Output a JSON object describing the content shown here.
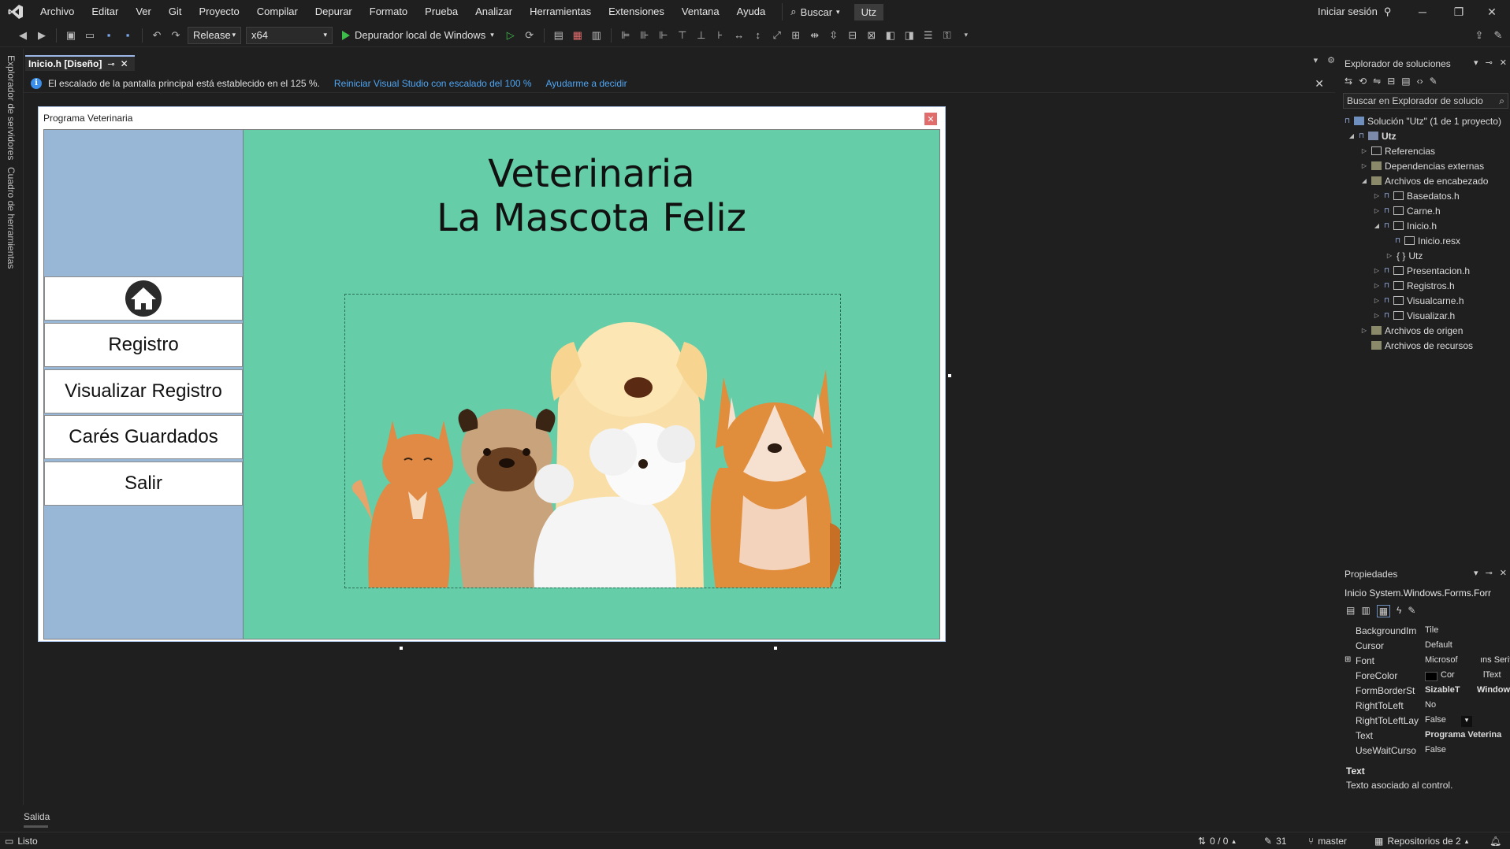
{
  "menubar": {
    "items": [
      "Archivo",
      "Editar",
      "Ver",
      "Git",
      "Proyecto",
      "Compilar",
      "Depurar",
      "Formato",
      "Prueba",
      "Analizar",
      "Herramientas",
      "Extensiones",
      "Ventana",
      "Ayuda"
    ],
    "search_label": "Buscar",
    "project_badge": "Utz",
    "signin": "Iniciar sesión"
  },
  "toolbar": {
    "configuration": "Release",
    "platform": "x64",
    "run_label": "Depurador local de Windows"
  },
  "left_strip": {
    "server_explorer": "Explorador de servidores",
    "toolbox": "Cuadro de herramientas"
  },
  "doc_tab": {
    "label": "Inicio.h [Diseño]"
  },
  "infobar": {
    "message": "El escalado de la pantalla principal está establecido en el 125 %.",
    "link_restart": "Reiniciar Visual Studio con escalado del 100 %",
    "link_help": "Ayudarme a decidir"
  },
  "form": {
    "title": "Programa Veterinaria",
    "main_title_line1": "Veterinaria",
    "main_title_line2": "La Mascota Feliz",
    "nav": {
      "registro": "Registro",
      "visualizar": "Visualizar Registro",
      "carnes": "Carés Guardados",
      "salir": "Salir"
    },
    "colors": {
      "side_panel": "#98b6d6",
      "main_panel": "#65cda8"
    }
  },
  "solution_explorer": {
    "title": "Explorador de soluciones",
    "search_placeholder": "Buscar en Explorador de solucio",
    "solution": "Solución \"Utz\" (1 de 1 proyecto)",
    "project": "Utz",
    "nodes": {
      "referencias": "Referencias",
      "dependencias": "Dependencias externas",
      "encabezado": "Archivos de encabezado",
      "basedatos": "Basedatos.h",
      "carne": "Carne.h",
      "inicio": "Inicio.h",
      "inicio_resx": "Inicio.resx",
      "utz_ns": "Utz",
      "presentacion": "Presentacion.h",
      "registros": "Registros.h",
      "visualcarne": "Visualcarne.h",
      "visualizar": "Visualizar.h",
      "origen": "Archivos de origen",
      "recursos": "Archivos de recursos"
    }
  },
  "properties": {
    "title": "Propiedades",
    "object": "Inicio  System.Windows.Forms.Forr",
    "rows": {
      "background": {
        "name": "BackgroundIm",
        "value": "Tile"
      },
      "cursor": {
        "name": "Cursor",
        "value": "Default"
      },
      "font": {
        "name": "Font",
        "value": "Microsof"
      },
      "font_extra": "ıns Serif,",
      "forecolor": {
        "name": "ForeColor",
        "value": "Cor"
      },
      "forecolor_extra": "lText",
      "border": {
        "name": "FormBorderSt",
        "value": "SizableT"
      },
      "border_extra": "Window",
      "rtl": {
        "name": "RightToLeft",
        "value": "No"
      },
      "rtl_layout": {
        "name": "RightToLeftLay",
        "value": "False"
      },
      "text": {
        "name": "Text",
        "value": "Programa Veterina"
      },
      "wait": {
        "name": "UseWaitCurso",
        "value": "False"
      }
    },
    "desc_title": "Text",
    "desc": "Texto asociado al control."
  },
  "output": {
    "label": "Salida"
  },
  "status": {
    "ready": "Listo",
    "sync": "0 / 0",
    "edits": "31",
    "branch": "master",
    "repos": "Repositorios de 2"
  }
}
